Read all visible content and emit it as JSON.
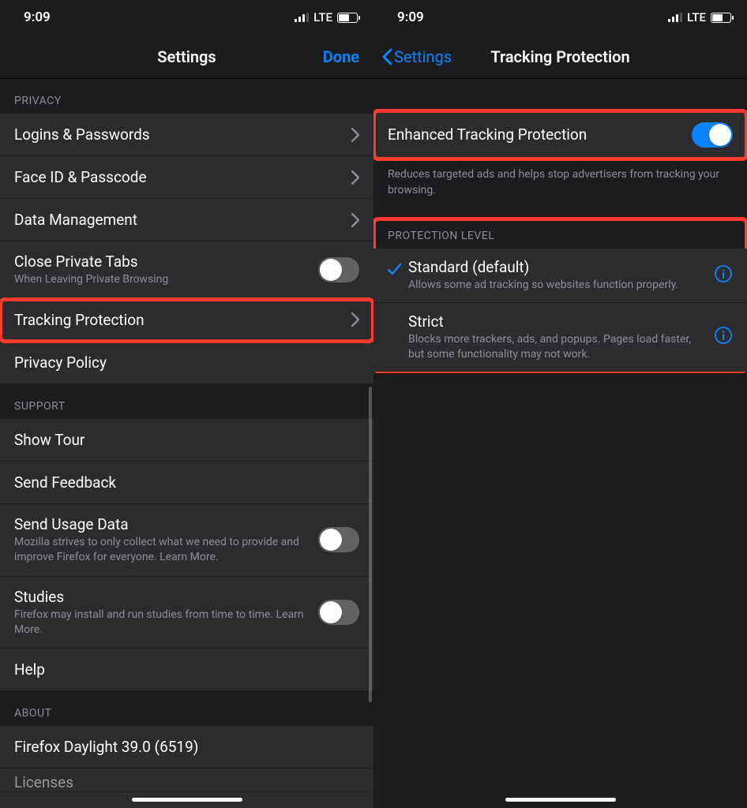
{
  "status": {
    "time": "9:09",
    "carrier": "LTE"
  },
  "left": {
    "nav": {
      "title": "Settings",
      "done": "Done"
    },
    "sections": {
      "privacy": {
        "header": "PRIVACY",
        "logins": "Logins & Passwords",
        "faceid": "Face ID & Passcode",
        "data_mgmt": "Data Management",
        "close_tabs": {
          "title": "Close Private Tabs",
          "sub": "When Leaving Private Browsing"
        },
        "tracking": "Tracking Protection",
        "privacy_policy": "Privacy Policy"
      },
      "support": {
        "header": "SUPPORT",
        "show_tour": "Show Tour",
        "send_feedback": "Send Feedback",
        "send_usage": {
          "title": "Send Usage Data",
          "sub": "Mozilla strives to only collect what we need to provide and improve Firefox for everyone. Learn More."
        },
        "studies": {
          "title": "Studies",
          "sub": "Firefox may install and run studies from time to time. Learn More."
        },
        "help": "Help"
      },
      "about": {
        "header": "ABOUT",
        "version": "Firefox Daylight 39.0 (6519)",
        "licenses": "Licenses"
      }
    }
  },
  "right": {
    "nav": {
      "back": "Settings",
      "title": "Tracking Protection"
    },
    "etp": {
      "title": "Enhanced Tracking Protection",
      "desc": "Reduces targeted ads and helps stop advertisers from tracking your browsing."
    },
    "level": {
      "header": "PROTECTION LEVEL",
      "standard": {
        "title": "Standard (default)",
        "sub": "Allows some ad tracking so websites function properly."
      },
      "strict": {
        "title": "Strict",
        "sub": "Blocks more trackers, ads, and popups. Pages load faster, but some functionality may not work."
      }
    }
  }
}
